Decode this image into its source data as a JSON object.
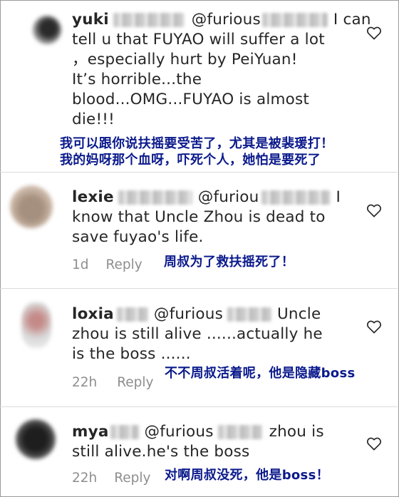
{
  "comments": [
    {
      "username": "yuki",
      "mention": "@furious",
      "lines": [
        "tell u that FUYAO will suffer a lot",
        "，especially hurt by PeiYuan!",
        "It’s horrible...the",
        "blood...OMG...FUYAO is almost",
        "die!!!"
      ],
      "first_line_tail": "I can",
      "caption_lines": [
        "我可以跟你说扶摇要受苦了，尤其是被裴瑗打！",
        "我的妈呀那个血呀，吓死个人，她怕是要死了"
      ]
    },
    {
      "username": "lexie",
      "mention": "@furiou",
      "first_line_tail": "I",
      "lines": [
        "know that Uncle Zhou is dead to",
        "save fuyao's life."
      ],
      "time": "1d",
      "reply": "Reply",
      "caption_lines": [
        "周叔为了救扶摇死了！"
      ]
    },
    {
      "username": "loxia",
      "mention": "@furious",
      "first_line_tail": "Uncle",
      "lines": [
        "zhou  is still alive ......actually  he",
        "is the boss ......"
      ],
      "time": "22h",
      "reply": "Reply",
      "caption_lines": [
        "不不周叔活着呢，他是隐藏boss"
      ]
    },
    {
      "username": "mya",
      "mention": "@furious",
      "first_line_tail": "zhou is",
      "lines": [
        "still alive.he's the boss"
      ],
      "time": "22h",
      "reply": "Reply",
      "caption_lines": [
        "对啊周叔没死，他是boss！"
      ]
    }
  ]
}
